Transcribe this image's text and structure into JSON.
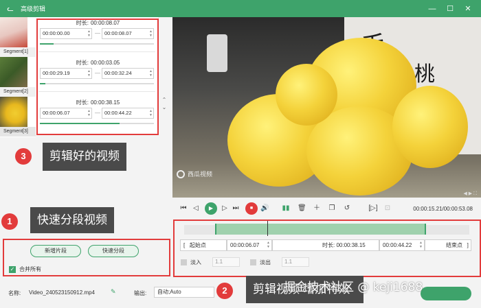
{
  "window": {
    "title": "高级剪辑",
    "controls": [
      "—",
      "☐",
      "✕"
    ]
  },
  "segments": [
    {
      "label": "Segment[1]",
      "duration_label": "时长:",
      "duration": "00:00:08.07",
      "start": "00:00:00.00",
      "end": "00:00:08.07",
      "progress": 0.12
    },
    {
      "label": "Segment[2]",
      "duration_label": "时长:",
      "duration": "00:00:03.05",
      "start": "00:00:29.19",
      "end": "00:00:32.24",
      "progress": 0.05
    },
    {
      "label": "Segment[3]",
      "duration_label": "时长:",
      "duration": "00:00:38.15",
      "start": "00:00:06.07",
      "end": "00:00:44.22",
      "progress": 0.7
    }
  ],
  "annotations": {
    "a1": {
      "num": "1",
      "text": "快速分段视频"
    },
    "a2": {
      "num": "2",
      "text": "剪辑视频 增加特效"
    },
    "a3": {
      "num": "3",
      "text": "剪辑好的视频"
    }
  },
  "left_panel": {
    "new_segment": "新增片段",
    "quick_split": "快速分段",
    "merge_all": "合并所有"
  },
  "video": {
    "watermark": "西瓜视频",
    "glyph_top": "毛",
    "glyph_bottom": "桃"
  },
  "transport": {
    "timecode": "00:00:15.21/00:00:53.08"
  },
  "editor": {
    "start_point": "起始点",
    "start_time": "00:00:06.07",
    "duration_label": "时长:",
    "duration": "00:00:38.15",
    "end_time": "00:00:44.22",
    "end_point": "结束点",
    "fade_in": "淡入",
    "fade_in_value": "1.1",
    "fade_out": "淡出",
    "fade_out_value": "1.1"
  },
  "bottom": {
    "name_label": "名称:",
    "file_name": "Video_240523150912.mp4",
    "output_label": "输出:",
    "output_value": "自动;Auto"
  },
  "overlay_watermark": "掘金技术社区 @ keji1688",
  "colors": {
    "accent": "#3ea36b",
    "annotation_red": "#e23b3b"
  }
}
